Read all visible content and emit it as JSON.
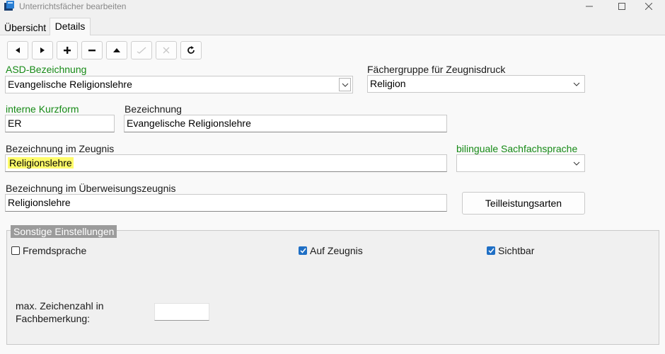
{
  "window": {
    "title": "Unterrichtsfächer bearbeiten",
    "controls": {
      "minimize": "—",
      "maximize": "☐",
      "close": "✕"
    }
  },
  "tabs": [
    {
      "label": "Übersicht",
      "active": false
    },
    {
      "label": "Details",
      "active": true
    }
  ],
  "toolbar": {
    "buttons": [
      {
        "icon": "arrow-left-icon",
        "enabled": true
      },
      {
        "icon": "arrow-right-icon",
        "enabled": true
      },
      {
        "icon": "plus-icon",
        "enabled": true
      },
      {
        "icon": "minus-icon",
        "enabled": true
      },
      {
        "icon": "arrow-up-icon",
        "enabled": true
      },
      {
        "icon": "check-icon",
        "enabled": false
      },
      {
        "icon": "cancel-icon",
        "enabled": false
      },
      {
        "icon": "refresh-icon",
        "enabled": true
      }
    ]
  },
  "form": {
    "asd": {
      "label": "ASD-Bezeichnung",
      "value": "Evangelische Religionslehre"
    },
    "faechergruppe": {
      "label": "Fächergruppe für Zeugnisdruck",
      "value": "Religion"
    },
    "kurzform": {
      "label": "interne Kurzform",
      "value": "ER"
    },
    "bezeichnung": {
      "label": "Bezeichnung",
      "value": "Evangelische Religionslehre"
    },
    "zeugnis": {
      "label": "Bezeichnung im Zeugnis",
      "value": "Religionslehre"
    },
    "bilingual": {
      "label": "bilinguale Sachfachsprache",
      "value": ""
    },
    "ueberweisung": {
      "label": "Bezeichnung im Überweisungszeugnis",
      "value": "Religionslehre"
    },
    "teilleistungsarten_button": "Teilleistungsarten"
  },
  "sonstige": {
    "title": "Sonstige Einstellungen",
    "fremdsprache": {
      "label": "Fremdsprache",
      "checked": false
    },
    "auf_zeugnis": {
      "label": "Auf Zeugnis",
      "checked": true
    },
    "sichtbar": {
      "label": "Sichtbar",
      "checked": true
    },
    "max_zeichen": {
      "label_line1": "max. Zeichenzahl in",
      "label_line2": "Fachbemerkung:",
      "value": ""
    }
  },
  "colors": {
    "required_label": "#168a16",
    "checkbox_checked": "#1f6fc5",
    "highlight": "#fffc6a",
    "group_title_bg": "#9b9b9b"
  }
}
